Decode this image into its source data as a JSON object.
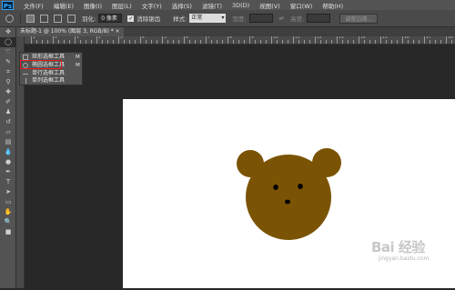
{
  "app": {
    "logo": "Ps"
  },
  "menu": [
    "文件(F)",
    "编辑(E)",
    "图像(I)",
    "图层(L)",
    "文字(Y)",
    "选择(S)",
    "滤镜(T)",
    "3D(D)",
    "视图(V)",
    "窗口(W)",
    "帮助(H)"
  ],
  "options": {
    "feather_label": "羽化:",
    "feather_value": "0 像素",
    "antialias_label": "消除锯齿",
    "antialias_checked": true,
    "style_label": "样式:",
    "style_value": "正常",
    "width_label": "宽度:",
    "height_label": "高度:",
    "refine_button": "调整边缘..."
  },
  "document_tab": {
    "title": "未标题-1 @ 100% (图层 3, RGB/8) * ×"
  },
  "ruler": {
    "labels": [
      "1",
      "0",
      "1",
      "2",
      "3",
      "4",
      "5",
      "6",
      "7",
      "8",
      "9",
      "10",
      "11",
      "12",
      "13",
      "14",
      "15",
      "16",
      "17",
      "18"
    ]
  },
  "flyout": {
    "items": [
      {
        "label": "矩形选框工具",
        "shortcut": "M",
        "icon": "rect-marquee-icon"
      },
      {
        "label": "椭圆选框工具",
        "shortcut": "M",
        "icon": "ellipse-marquee-icon"
      },
      {
        "label": "单行选框工具",
        "shortcut": "",
        "icon": "single-row-marquee-icon"
      },
      {
        "label": "单列选框工具",
        "shortcut": "",
        "icon": "single-column-marquee-icon"
      }
    ]
  },
  "tools": [
    "move-icon",
    "marquee-icon",
    "lasso-icon",
    "quick-select-icon",
    "crop-icon",
    "eyedropper-icon",
    "healing-icon",
    "brush-icon",
    "stamp-icon",
    "history-brush-icon",
    "eraser-icon",
    "gradient-icon",
    "blur-icon",
    "dodge-icon",
    "pen-icon",
    "type-icon",
    "path-select-icon",
    "shape-icon",
    "hand-icon",
    "zoom-icon",
    "color-swatch-icon"
  ],
  "colors": {
    "bear_fur": "#7a5304",
    "bear_features": "#000000",
    "canvas": "#ffffff",
    "highlight": "#e02020"
  },
  "watermark": {
    "brand": "Bai 经验",
    "url": "jingyan.baidu.com"
  }
}
